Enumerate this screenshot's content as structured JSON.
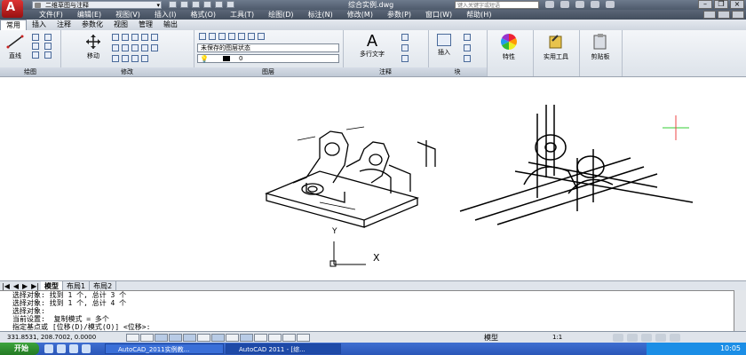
{
  "title_bar": {
    "workspace": "二维草图与注释",
    "window_title": "综合实例.dwg",
    "search_placeholder": "键入关键字或短语"
  },
  "menu": [
    "文件(F)",
    "编辑(E)",
    "视图(V)",
    "插入(I)",
    "格式(O)",
    "工具(T)",
    "绘图(D)",
    "标注(N)",
    "修改(M)",
    "参数(P)",
    "窗口(W)",
    "帮助(H)"
  ],
  "ribbon_tabs": [
    "常用",
    "插入",
    "注释",
    "参数化",
    "视图",
    "管理",
    "输出"
  ],
  "ribbon": {
    "draw": {
      "line": "直线",
      "label": "绘图"
    },
    "modify": {
      "move": "移动",
      "label": "修改"
    },
    "layers": {
      "state": "未保存的图层状态",
      "current": "0",
      "label": "图层"
    },
    "annotation": {
      "mtext": "多行文字",
      "label": "注释"
    },
    "block": {
      "insert": "插入",
      "label": "块"
    },
    "properties": {
      "label": "特性"
    },
    "utilities": {
      "label": "实用工具"
    },
    "clipboard": {
      "label": "剪贴板"
    }
  },
  "layout_tabs": [
    "模型",
    "布局1",
    "布局2"
  ],
  "ucs": {
    "y": "Y",
    "x": "X"
  },
  "command_history": [
    "选择对象: 找到 1 个, 总计 3 个",
    "选择对象: 找到 1 个, 总计 4 个",
    "选择对象:",
    "当前设置:  复制模式 = 多个",
    "指定基点或 [位移(D)/模式(O)] <位移>:"
  ],
  "status": {
    "coords": "331.8531, 208.7002, 0.0000",
    "model": "模型",
    "scale": "1:1"
  },
  "taskbar": {
    "start": "开始",
    "task1": "AutoCAD_2011实例教...",
    "task2": "AutoCAD 2011 - [综...",
    "clock": "10:05"
  },
  "colors": {
    "accent": "#b51a1a",
    "ribbon": "#dde3ea",
    "taskbar": "#2a56b8"
  }
}
